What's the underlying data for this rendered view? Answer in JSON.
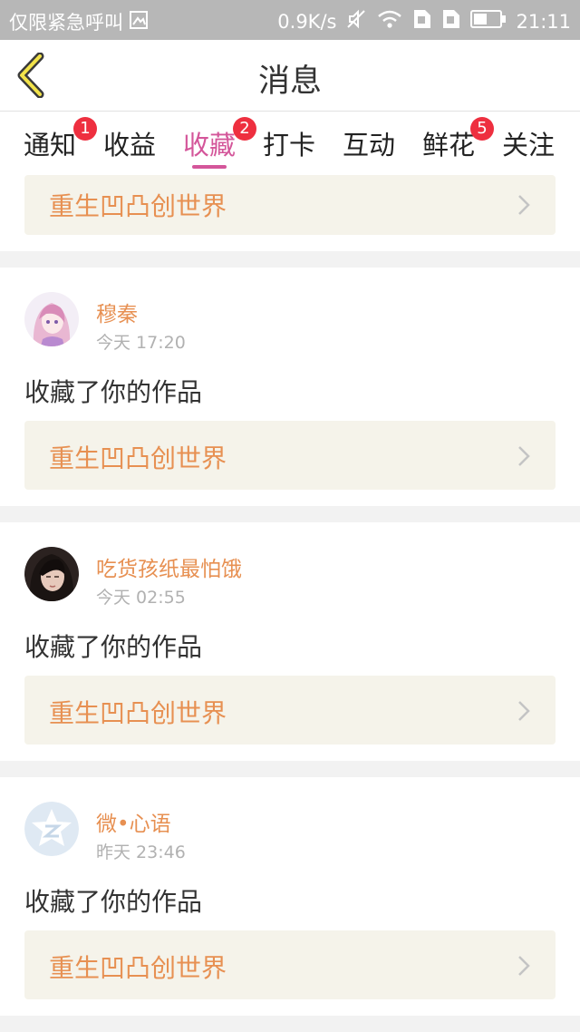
{
  "status_bar": {
    "carrier": "仅限紧急呼叫",
    "speed": "0.9K/s",
    "time": "21:11"
  },
  "header": {
    "title": "消息"
  },
  "tabs": [
    {
      "label": "通知",
      "badge": "1",
      "active": false
    },
    {
      "label": "收益",
      "badge": "",
      "active": false
    },
    {
      "label": "收藏",
      "badge": "2",
      "active": true
    },
    {
      "label": "打卡",
      "badge": "",
      "active": false
    },
    {
      "label": "互动",
      "badge": "",
      "active": false
    },
    {
      "label": "鲜花",
      "badge": "5",
      "active": false
    },
    {
      "label": "关注",
      "badge": "",
      "active": false
    }
  ],
  "partial_card": {
    "work_title": "重生凹凸创世界"
  },
  "cards": [
    {
      "username": "穆秦",
      "time": "今天 17:20",
      "message": "收藏了你的作品",
      "work_title": "重生凹凸创世界",
      "avatar_icon": "anime-girl-avatar"
    },
    {
      "username": "吃货孩纸最怕饿",
      "time": "今天 02:55",
      "message": "收藏了你的作品",
      "work_title": "重生凹凸创世界",
      "avatar_icon": "photo-girl-avatar"
    },
    {
      "username": "微•心语",
      "time": "昨天 23:46",
      "message": "收藏了你的作品",
      "work_title": "重生凹凸创世界",
      "avatar_icon": "qzone-star-avatar"
    }
  ],
  "colors": {
    "accent": "#d4569a",
    "name": "#e79052",
    "badge": "#ee2f3f",
    "work_bg": "#f5f3ea"
  }
}
